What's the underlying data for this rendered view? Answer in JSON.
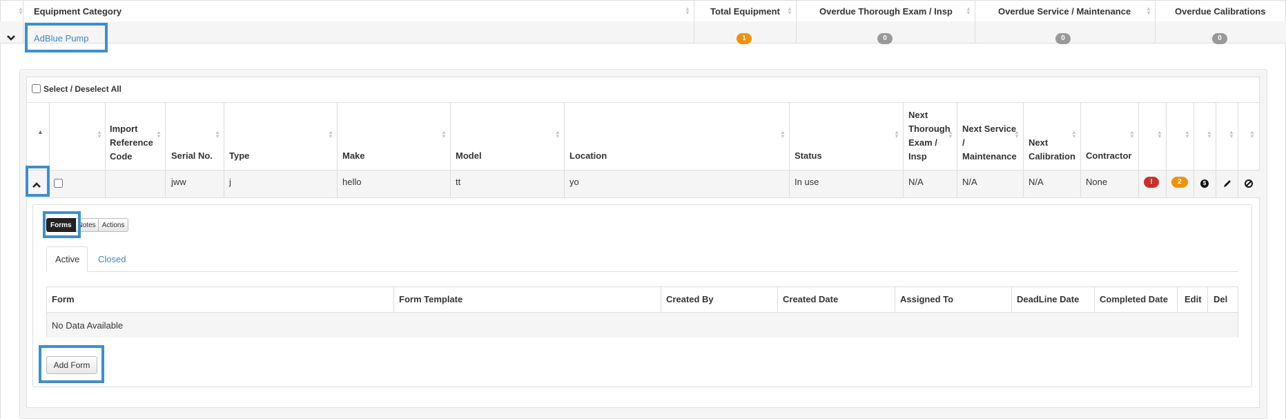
{
  "outer_table": {
    "headers": [
      "Equipment Category",
      "Total Equipment",
      "Overdue Thorough Exam / Insp",
      "Overdue Service / Maintenance",
      "Overdue Calibrations"
    ],
    "row": {
      "category": "AdBlue Pump",
      "total": "1",
      "overdue_exam": "0",
      "overdue_service": "0",
      "overdue_calibrations": "0"
    }
  },
  "panel": {
    "select_all_label": "Select / Deselect All",
    "headers": [
      "Import Reference Code",
      "Serial No.",
      "Type",
      "Make",
      "Model",
      "Location",
      "Status",
      "Next Thorough Exam / Insp",
      "Next Service / Maintenance",
      "Next Calibration",
      "Contractor"
    ],
    "row": {
      "import_ref": "",
      "serial": "jww",
      "type": "j",
      "make": "hello",
      "model": "tt",
      "location": "yo",
      "status": "In use",
      "next_exam": "N/A",
      "next_service": "N/A",
      "next_calibration": "N/A",
      "contractor": "None",
      "alert_badge": "!",
      "count_badge": "2"
    }
  },
  "detail": {
    "button_group": [
      "Forms",
      "Notes",
      "Actions"
    ],
    "tabs": [
      "Active",
      "Closed"
    ],
    "forms_headers": [
      "Form",
      "Form Template",
      "Created By",
      "Created Date",
      "Assigned To",
      "DeadLine Date",
      "Completed Date",
      "Edit",
      "Del"
    ],
    "empty_message": "No Data Available",
    "add_form_label": "Add Form"
  },
  "colors": {
    "highlight": "#3b8fd0",
    "link": "#3d86c6",
    "orange_badge": "#f0920c",
    "grey_badge": "#999999",
    "red_badge": "#c9302c"
  }
}
